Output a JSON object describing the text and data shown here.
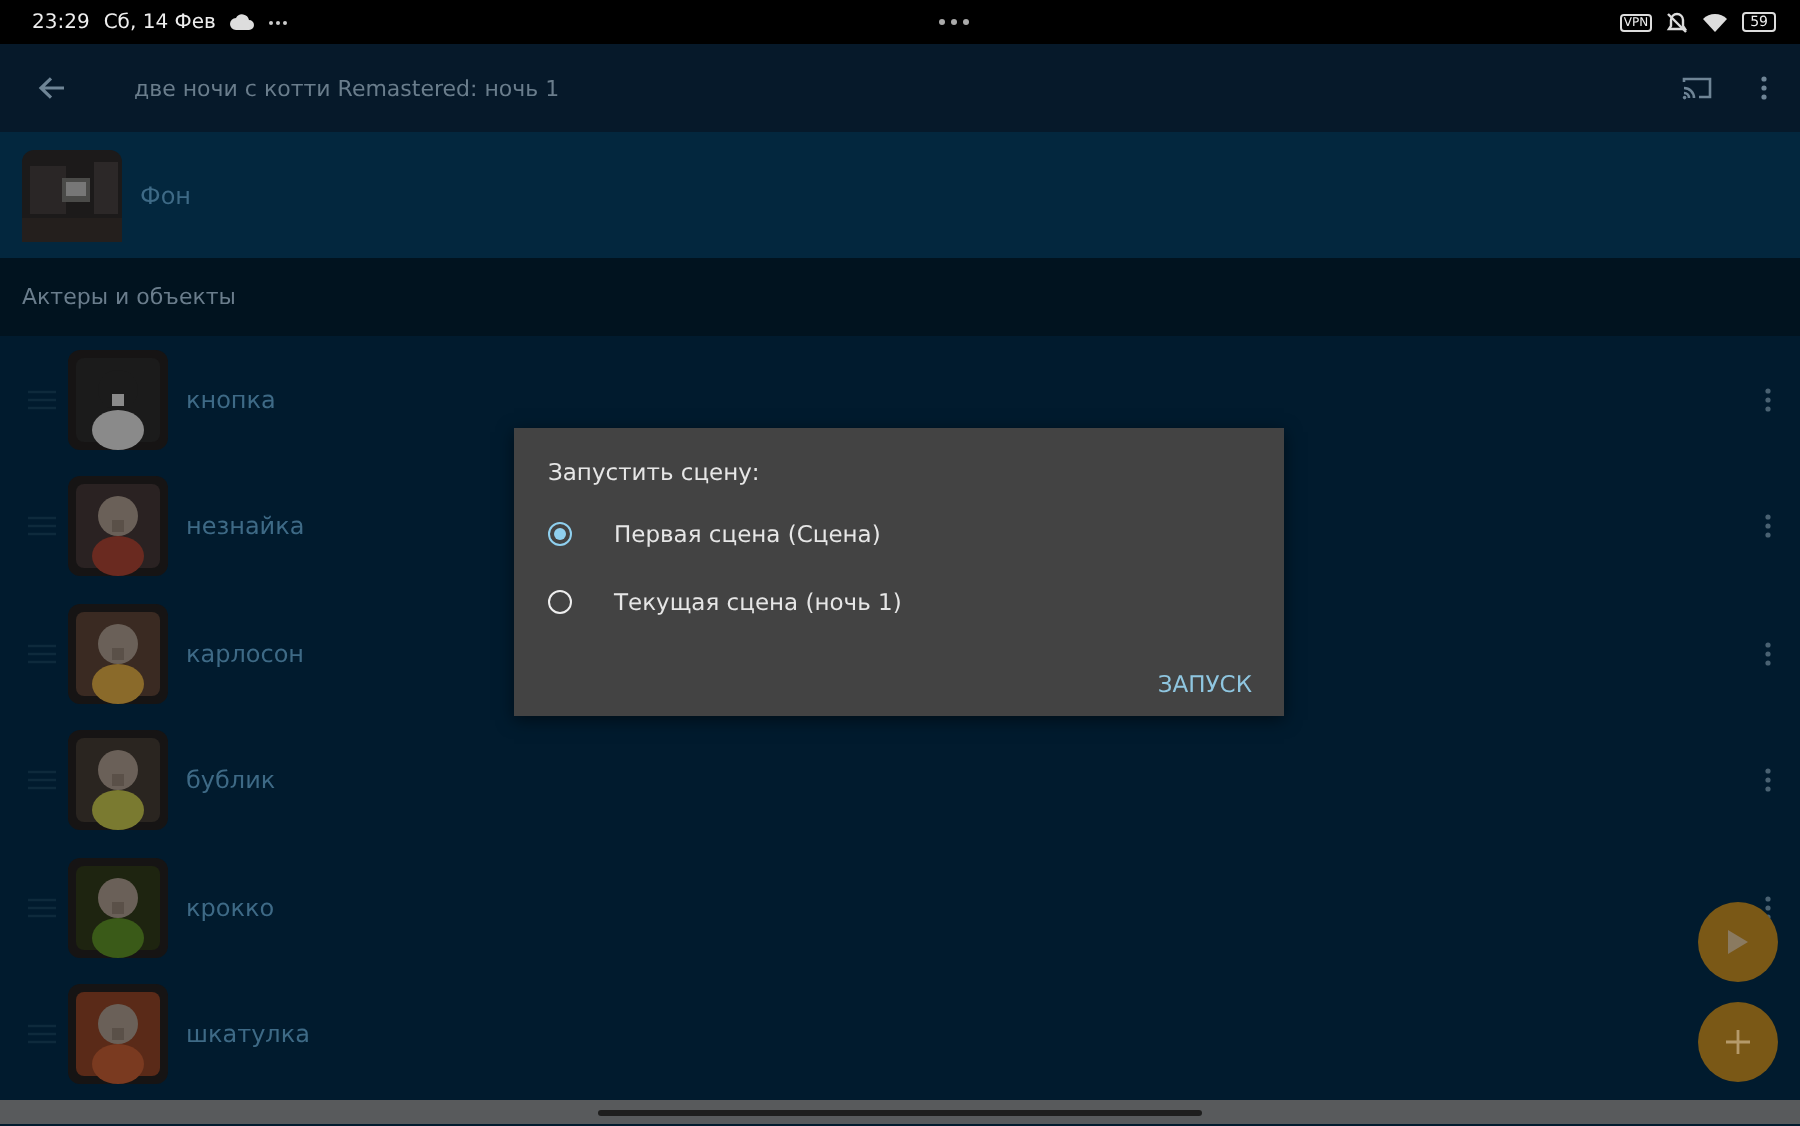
{
  "status_bar": {
    "time": "23:29",
    "date": "Сб, 14 Фев",
    "vpn": "VPN",
    "battery": "59"
  },
  "app_bar": {
    "title": "две ночи с котти Remastered: ночь 1"
  },
  "background": {
    "label": "Фон"
  },
  "section": {
    "title": "Актеры и объекты"
  },
  "items": [
    {
      "name": "кнопка"
    },
    {
      "name": "незнайка"
    },
    {
      "name": "карлосон"
    },
    {
      "name": "бублик"
    },
    {
      "name": "крокко"
    },
    {
      "name": "шкатулка"
    }
  ],
  "dialog": {
    "title": "Запустить сцену:",
    "options": [
      {
        "label": "Первая сцена (Сцена)",
        "selected": true
      },
      {
        "label": "Текущая сцена (ночь 1)",
        "selected": false
      }
    ],
    "button": "ЗАПУСК"
  }
}
